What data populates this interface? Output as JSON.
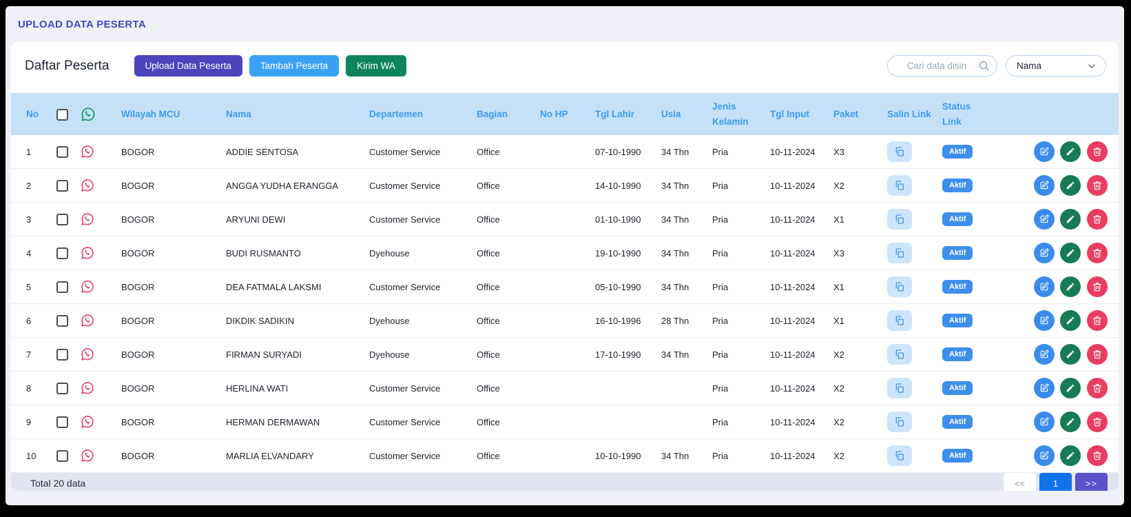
{
  "page": {
    "title": "UPLOAD DATA PESERTA"
  },
  "toolbar": {
    "heading": "Daftar Peserta",
    "buttons": {
      "upload": "Upload Data Peserta",
      "tambah": "Tambah Peserta",
      "kirim_wa": "Kirim WA"
    },
    "search": {
      "placeholder": "Cari data disin",
      "icon": "search-icon"
    },
    "filter": {
      "selected": "Nama",
      "icon": "chevron-down-icon"
    }
  },
  "table": {
    "columns": {
      "no": "No",
      "wilayah": "Wilayah MCU",
      "nama": "Nama",
      "departemen": "Departemen",
      "bagian": "Bagian",
      "no_hp": "No HP",
      "tgl_lahir": "Tgl Lahir",
      "usia": "Usia",
      "jenis_kelamin": "Jenis Kelamin",
      "tgl_input": "Tgl Input",
      "paket": "Paket",
      "salin_link": "Salin Link",
      "status_link": "Status Link"
    },
    "rows": [
      {
        "no": "1",
        "wilayah": "BOGOR",
        "nama": "ADDIE SENTOSA",
        "departemen": "Customer Service",
        "bagian": "Office",
        "no_hp": "",
        "tgl_lahir": "07-10-1990",
        "usia": "34 Thn",
        "jenis_kelamin": "Pria",
        "tgl_input": "10-11-2024",
        "paket": "X3",
        "status": "Aktif"
      },
      {
        "no": "2",
        "wilayah": "BOGOR",
        "nama": "ANGGA YUDHA ERANGGA",
        "departemen": "Customer Service",
        "bagian": "Office",
        "no_hp": "",
        "tgl_lahir": "14-10-1990",
        "usia": "34 Thn",
        "jenis_kelamin": "Pria",
        "tgl_input": "10-11-2024",
        "paket": "X2",
        "status": "Aktif"
      },
      {
        "no": "3",
        "wilayah": "BOGOR",
        "nama": "ARYUNI DEWI",
        "departemen": "Customer Service",
        "bagian": "Office",
        "no_hp": "",
        "tgl_lahir": "01-10-1990",
        "usia": "34 Thn",
        "jenis_kelamin": "Pria",
        "tgl_input": "10-11-2024",
        "paket": "X1",
        "status": "Aktif"
      },
      {
        "no": "4",
        "wilayah": "BOGOR",
        "nama": "BUDI RUSMANTO",
        "departemen": "Dyehouse",
        "bagian": "Office",
        "no_hp": "",
        "tgl_lahir": "19-10-1990",
        "usia": "34 Thn",
        "jenis_kelamin": "Pria",
        "tgl_input": "10-11-2024",
        "paket": "X3",
        "status": "Aktif"
      },
      {
        "no": "5",
        "wilayah": "BOGOR",
        "nama": "DEA FATMALA LAKSMI",
        "departemen": "Customer Service",
        "bagian": "Office",
        "no_hp": "",
        "tgl_lahir": "05-10-1990",
        "usia": "34 Thn",
        "jenis_kelamin": "Pria",
        "tgl_input": "10-11-2024",
        "paket": "X1",
        "status": "Aktif"
      },
      {
        "no": "6",
        "wilayah": "BOGOR",
        "nama": "DIKDIK SADIKIN",
        "departemen": "Dyehouse",
        "bagian": "Office",
        "no_hp": "",
        "tgl_lahir": "16-10-1996",
        "usia": "28 Thn",
        "jenis_kelamin": "Pria",
        "tgl_input": "10-11-2024",
        "paket": "X1",
        "status": "Aktif"
      },
      {
        "no": "7",
        "wilayah": "BOGOR",
        "nama": "FIRMAN SURYADI",
        "departemen": "Dyehouse",
        "bagian": "Office",
        "no_hp": "",
        "tgl_lahir": "17-10-1990",
        "usia": "34 Thn",
        "jenis_kelamin": "Pria",
        "tgl_input": "10-11-2024",
        "paket": "X2",
        "status": "Aktif"
      },
      {
        "no": "8",
        "wilayah": "BOGOR",
        "nama": "HERLINA WATI",
        "departemen": "Customer Service",
        "bagian": "Office",
        "no_hp": "",
        "tgl_lahir": "",
        "usia": "",
        "jenis_kelamin": "Pria",
        "tgl_input": "10-11-2024",
        "paket": "X2",
        "status": "Aktif"
      },
      {
        "no": "9",
        "wilayah": "BOGOR",
        "nama": "HERMAN DERMAWAN",
        "departemen": "Customer Service",
        "bagian": "Office",
        "no_hp": "",
        "tgl_lahir": "",
        "usia": "",
        "jenis_kelamin": "Pria",
        "tgl_input": "10-11-2024",
        "paket": "X2",
        "status": "Aktif"
      },
      {
        "no": "10",
        "wilayah": "BOGOR",
        "nama": "MARLIA ELVANDARY",
        "departemen": "Customer Service",
        "bagian": "Office",
        "no_hp": "",
        "tgl_lahir": "10-10-1990",
        "usia": "34 Thn",
        "jenis_kelamin": "Pria",
        "tgl_input": "10-11-2024",
        "paket": "X2",
        "status": "Aktif"
      }
    ]
  },
  "footer": {
    "total": "Total 20 data",
    "pagination": {
      "prev": "<<",
      "current": "1",
      "next": ">>"
    }
  },
  "colors": {
    "title": "#4645c4",
    "btn_upload": "#4d43bc",
    "btn_tambah": "#3ba1f4",
    "btn_kirim_wa": "#10845c",
    "table_header_bg": "#c5e1f8",
    "table_header_text": "#3d9bed",
    "whatsapp_header_icon": "#149a55",
    "whatsapp_row_icon": "#e73c63",
    "status_badge": "#3d8fea",
    "action_edit": "#3b8beb",
    "action_pencil": "#167c55",
    "action_delete": "#e83e5f",
    "page_current": "#1272e8",
    "page_next": "#5b51c8",
    "footer_bg": "#e2e4f0"
  }
}
